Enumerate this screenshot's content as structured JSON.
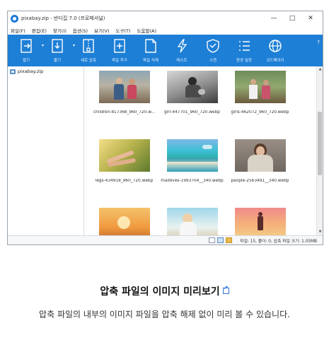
{
  "window": {
    "title": "pixabay.zip - 반디집 7.0 (프로페셔널)",
    "controls": [
      "—",
      "□",
      "✕"
    ]
  },
  "menu": [
    "파일(F)",
    "편집(E)",
    "찾기(I)",
    "옵션(S)",
    "보기(V)",
    "도구(T)",
    "도움말(A)"
  ],
  "toolbar": {
    "items": [
      {
        "label": "열기",
        "icon": "open-icon"
      },
      {
        "label": "풀기",
        "icon": "extract-icon"
      },
      {
        "label": "새로 압축",
        "icon": "new-archive-icon"
      },
      {
        "label": "파일 추가",
        "icon": "add-file-icon"
      },
      {
        "label": "파일 삭제",
        "icon": "delete-file-icon"
      },
      {
        "label": "테스트",
        "icon": "test-icon"
      },
      {
        "label": "스캔",
        "icon": "scan-icon"
      },
      {
        "label": "환경 설정",
        "icon": "settings-icon"
      },
      {
        "label": "코드페이지",
        "icon": "codepage-icon"
      }
    ],
    "help": "?"
  },
  "tree": {
    "root": "pixabay.zip"
  },
  "files": [
    {
      "name": "children-817368_960_720.w...",
      "thumb": "kids"
    },
    {
      "name": "girl-447701_960_720.webp",
      "thumb": "girl-bw"
    },
    {
      "name": "girls-462072_960_720.webp",
      "thumb": "girls"
    },
    {
      "name": "legs-434918_960_720.webp",
      "thumb": "legs"
    },
    {
      "name": "maldives-1993704__340.webp",
      "thumb": "maldives"
    },
    {
      "name": "people-2563491__340.webp",
      "thumb": "woman"
    },
    {
      "name": "",
      "thumb": "sunset-sea"
    },
    {
      "name": "",
      "thumb": "beach-woman"
    },
    {
      "name": "",
      "thumb": "silhouette"
    }
  ],
  "status": {
    "text": "파일: 15, 폴더: 0, 압축 파일 크기: 1.05MB"
  },
  "caption": {
    "title": "압축 파일의 이미지 미리보기",
    "body": "압축 파일의 내부의 이미지 파일을 압축 해제 없이 미리 볼 수 있습니다."
  },
  "colors": {
    "toolbar": "#1d7fd6",
    "link": "#2b72d6"
  }
}
